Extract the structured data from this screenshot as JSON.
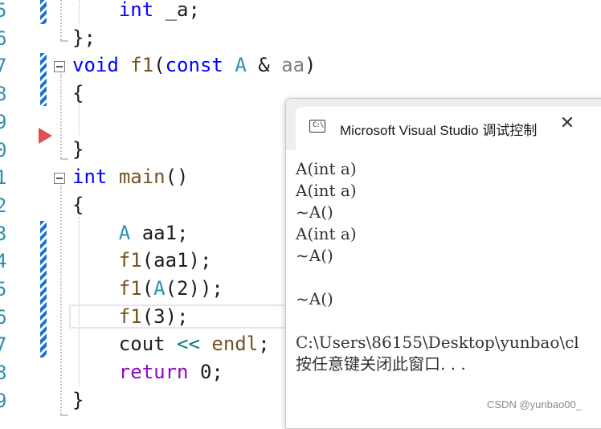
{
  "editor": {
    "line_numbers": [
      "5",
      "6",
      "7",
      "8",
      "9",
      "0",
      "1",
      "2",
      "3",
      "4",
      "5",
      "6",
      "7",
      "8",
      "9"
    ],
    "code_lines": [
      [
        {
          "t": "    ",
          "c": "pl"
        },
        {
          "t": "int",
          "c": "kw"
        },
        {
          "t": " _a;",
          "c": "pl"
        }
      ],
      [
        {
          "t": "};",
          "c": "pl"
        }
      ],
      [
        {
          "t": "void",
          "c": "kw"
        },
        {
          "t": " ",
          "c": "pl"
        },
        {
          "t": "f1",
          "c": "fn"
        },
        {
          "t": "(",
          "c": "pl"
        },
        {
          "t": "const",
          "c": "kw"
        },
        {
          "t": " ",
          "c": "pl"
        },
        {
          "t": "A",
          "c": "ty"
        },
        {
          "t": " & ",
          "c": "pl"
        },
        {
          "t": "aa",
          "c": "pm"
        },
        {
          "t": ")",
          "c": "pl"
        }
      ],
      [
        {
          "t": "{",
          "c": "pl"
        }
      ],
      [
        {
          "t": "",
          "c": "pl"
        }
      ],
      [
        {
          "t": "}",
          "c": "pl"
        }
      ],
      [
        {
          "t": "int",
          "c": "kw"
        },
        {
          "t": " ",
          "c": "pl"
        },
        {
          "t": "main",
          "c": "fn"
        },
        {
          "t": "()",
          "c": "pl"
        }
      ],
      [
        {
          "t": "{",
          "c": "pl"
        }
      ],
      [
        {
          "t": "    ",
          "c": "pl"
        },
        {
          "t": "A",
          "c": "ty"
        },
        {
          "t": " aa1;",
          "c": "pl"
        }
      ],
      [
        {
          "t": "    ",
          "c": "pl"
        },
        {
          "t": "f1",
          "c": "fn"
        },
        {
          "t": "(aa1);",
          "c": "pl"
        }
      ],
      [
        {
          "t": "    ",
          "c": "pl"
        },
        {
          "t": "f1",
          "c": "fn"
        },
        {
          "t": "(",
          "c": "pl"
        },
        {
          "t": "A",
          "c": "ty"
        },
        {
          "t": "(2));",
          "c": "pl"
        }
      ],
      [
        {
          "t": "    ",
          "c": "pl"
        },
        {
          "t": "f1",
          "c": "fn"
        },
        {
          "t": "(3);",
          "c": "pl"
        }
      ],
      [
        {
          "t": "    cout ",
          "c": "pl"
        },
        {
          "t": "<<",
          "c": "op"
        },
        {
          "t": " ",
          "c": "pl"
        },
        {
          "t": "endl",
          "c": "fn"
        },
        {
          "t": ";",
          "c": "pl"
        }
      ],
      [
        {
          "t": "    ",
          "c": "pl"
        },
        {
          "t": "return",
          "c": "kw2"
        },
        {
          "t": " 0;",
          "c": "pl"
        }
      ],
      [
        {
          "t": "}",
          "c": "pl"
        }
      ]
    ]
  },
  "console": {
    "tab_icon_text": "C:\\",
    "title": "Microsoft Visual Studio 调试控制台",
    "close_glyph": "✕",
    "output": [
      "A(int a)",
      "A(int a)",
      "~A()",
      "A(int a)",
      "~A()",
      "",
      "~A()",
      "",
      "C:\\Users\\86155\\Desktop\\yunbao\\cl",
      "按任意键关闭此窗口. . ."
    ]
  },
  "watermark": "CSDN @yunbao00_"
}
